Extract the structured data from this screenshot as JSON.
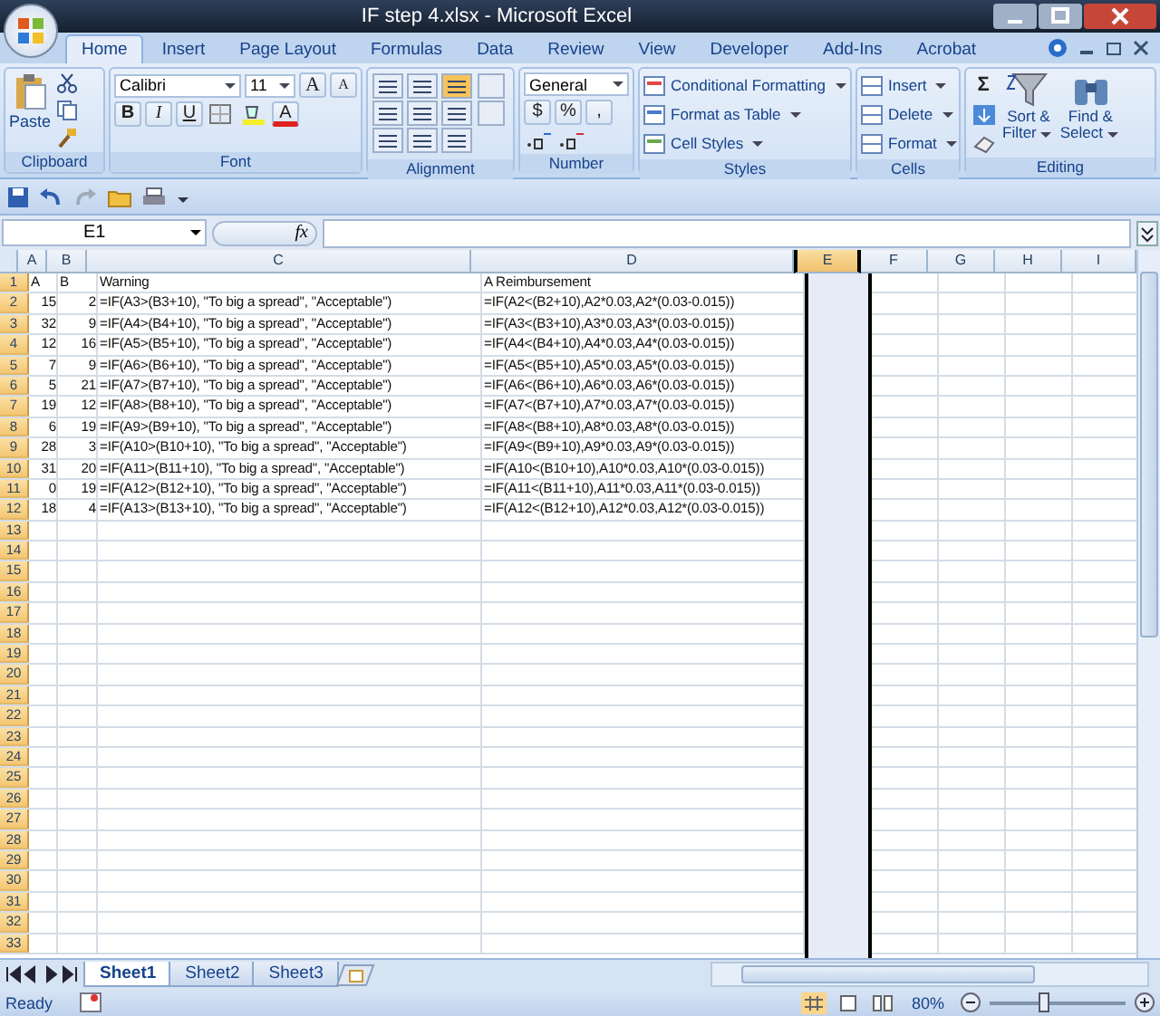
{
  "window": {
    "title": "IF step 4.xlsx - Microsoft Excel"
  },
  "tabs": [
    {
      "label": "Home",
      "selected": true
    },
    {
      "label": "Insert",
      "selected": false
    },
    {
      "label": "Page Layout",
      "selected": false
    },
    {
      "label": "Formulas",
      "selected": false
    },
    {
      "label": "Data",
      "selected": false
    },
    {
      "label": "Review",
      "selected": false
    },
    {
      "label": "View",
      "selected": false
    },
    {
      "label": "Developer",
      "selected": false
    },
    {
      "label": "Add-Ins",
      "selected": false
    },
    {
      "label": "Acrobat",
      "selected": false
    }
  ],
  "ribbon": {
    "clipboard": {
      "label": "Clipboard",
      "paste": "Paste"
    },
    "font": {
      "label": "Font",
      "name": "Calibri",
      "size": "11",
      "grow": "A",
      "shrink": "A",
      "bold": "B",
      "italic": "I",
      "underline": "U",
      "color_letter": "A"
    },
    "alignment": {
      "label": "Alignment"
    },
    "number": {
      "label": "Number",
      "format": "General",
      "currency": "$",
      "percent": "%",
      "comma": ","
    },
    "styles": {
      "label": "Styles",
      "items": [
        "Conditional Formatting",
        "Format as Table",
        "Cell Styles"
      ]
    },
    "cells": {
      "label": "Cells",
      "items": [
        "Insert",
        "Delete",
        "Format"
      ]
    },
    "editing": {
      "label": "Editing",
      "sum": "Σ",
      "sort": [
        "Sort &",
        "Filter"
      ],
      "find": [
        "Find &",
        "Select"
      ]
    }
  },
  "formula_bar": {
    "name_box": "E1",
    "fx": "fx"
  },
  "columns": [
    {
      "label": "A",
      "selected": false
    },
    {
      "label": "B",
      "selected": false
    },
    {
      "label": "C",
      "selected": false
    },
    {
      "label": "D",
      "selected": false
    },
    {
      "label": "E",
      "selected": true
    },
    {
      "label": "F",
      "selected": false
    },
    {
      "label": "G",
      "selected": false
    },
    {
      "label": "H",
      "selected": false
    },
    {
      "label": "I",
      "selected": false
    }
  ],
  "rows": [
    {
      "n": "1",
      "kind": "text",
      "cells": [
        "A",
        "B",
        "Warning",
        "A Reimbursement"
      ]
    },
    {
      "n": "2",
      "kind": "data",
      "cells": [
        "15",
        "2",
        "=IF(A3>(B3+10), \"To big a spread\", \"Acceptable\")",
        "=IF(A2<(B2+10),A2*0.03,A2*(0.03-0.015))"
      ]
    },
    {
      "n": "3",
      "kind": "data",
      "cells": [
        "32",
        "9",
        "=IF(A4>(B4+10), \"To big a spread\", \"Acceptable\")",
        "=IF(A3<(B3+10),A3*0.03,A3*(0.03-0.015))"
      ]
    },
    {
      "n": "4",
      "kind": "data",
      "cells": [
        "12",
        "16",
        "=IF(A5>(B5+10), \"To big a spread\", \"Acceptable\")",
        "=IF(A4<(B4+10),A4*0.03,A4*(0.03-0.015))"
      ]
    },
    {
      "n": "5",
      "kind": "data",
      "cells": [
        "7",
        "9",
        "=IF(A6>(B6+10), \"To big a spread\", \"Acceptable\")",
        "=IF(A5<(B5+10),A5*0.03,A5*(0.03-0.015))"
      ]
    },
    {
      "n": "6",
      "kind": "data",
      "cells": [
        "5",
        "21",
        "=IF(A7>(B7+10), \"To big a spread\", \"Acceptable\")",
        "=IF(A6<(B6+10),A6*0.03,A6*(0.03-0.015))"
      ]
    },
    {
      "n": "7",
      "kind": "data",
      "cells": [
        "19",
        "12",
        "=IF(A8>(B8+10), \"To big a spread\", \"Acceptable\")",
        "=IF(A7<(B7+10),A7*0.03,A7*(0.03-0.015))"
      ]
    },
    {
      "n": "8",
      "kind": "data",
      "cells": [
        "6",
        "19",
        "=IF(A9>(B9+10), \"To big a spread\", \"Acceptable\")",
        "=IF(A8<(B8+10),A8*0.03,A8*(0.03-0.015))"
      ]
    },
    {
      "n": "9",
      "kind": "data",
      "cells": [
        "28",
        "3",
        "=IF(A10>(B10+10), \"To big a spread\", \"Acceptable\")",
        "=IF(A9<(B9+10),A9*0.03,A9*(0.03-0.015))"
      ]
    },
    {
      "n": "10",
      "kind": "data",
      "cells": [
        "31",
        "20",
        "=IF(A11>(B11+10), \"To big a spread\", \"Acceptable\")",
        "=IF(A10<(B10+10),A10*0.03,A10*(0.03-0.015))"
      ]
    },
    {
      "n": "11",
      "kind": "data",
      "cells": [
        "0",
        "19",
        "=IF(A12>(B12+10), \"To big a spread\", \"Acceptable\")",
        "=IF(A11<(B11+10),A11*0.03,A11*(0.03-0.015))"
      ]
    },
    {
      "n": "12",
      "kind": "data",
      "cells": [
        "18",
        "4",
        "=IF(A13>(B13+10), \"To big a spread\", \"Acceptable\")",
        "=IF(A12<(B12+10),A12*0.03,A12*(0.03-0.015))"
      ]
    },
    {
      "n": "13",
      "kind": "empty"
    },
    {
      "n": "14",
      "kind": "empty"
    },
    {
      "n": "15",
      "kind": "empty"
    },
    {
      "n": "16",
      "kind": "empty"
    },
    {
      "n": "17",
      "kind": "empty"
    },
    {
      "n": "18",
      "kind": "empty"
    },
    {
      "n": "19",
      "kind": "empty"
    },
    {
      "n": "20",
      "kind": "empty"
    },
    {
      "n": "21",
      "kind": "empty"
    },
    {
      "n": "22",
      "kind": "empty"
    },
    {
      "n": "23",
      "kind": "empty"
    },
    {
      "n": "24",
      "kind": "empty"
    },
    {
      "n": "25",
      "kind": "empty"
    },
    {
      "n": "26",
      "kind": "empty"
    },
    {
      "n": "27",
      "kind": "empty"
    },
    {
      "n": "28",
      "kind": "empty"
    },
    {
      "n": "29",
      "kind": "empty"
    },
    {
      "n": "30",
      "kind": "empty"
    },
    {
      "n": "31",
      "kind": "empty"
    },
    {
      "n": "32",
      "kind": "empty"
    },
    {
      "n": "33",
      "kind": "empty"
    }
  ],
  "sheets": [
    {
      "label": "Sheet1",
      "selected": true
    },
    {
      "label": "Sheet2",
      "selected": false
    },
    {
      "label": "Sheet3",
      "selected": false
    }
  ],
  "status_bar": {
    "state": "Ready",
    "zoom": "80%",
    "zoom_slider": {
      "level": 0.4
    }
  }
}
